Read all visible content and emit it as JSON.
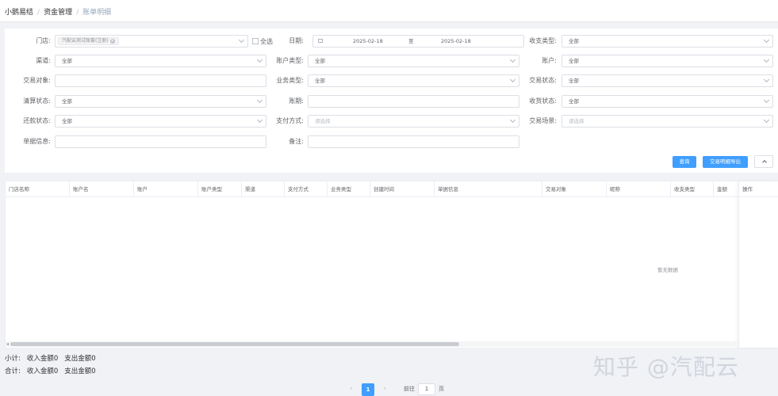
{
  "breadcrumb": {
    "items": [
      "小鹅易结",
      "资金管理",
      "账单明细"
    ],
    "separator": "/"
  },
  "filters": {
    "store": {
      "label": "门店:",
      "tag": "汽配云测试账套(注册)",
      "select_all_label": "全选"
    },
    "date": {
      "label": "日期:",
      "start": "2025-02-18",
      "separator": "至",
      "end": "2025-02-18"
    },
    "income_type": {
      "label": "收支类型:",
      "value": "全部"
    },
    "channel": {
      "label": "渠道:",
      "value": "全部"
    },
    "account_type": {
      "label": "账户类型:",
      "value": "全部"
    },
    "account": {
      "label": "账户:",
      "value": "全部"
    },
    "trade_object": {
      "label": "交易对象:",
      "value": ""
    },
    "business_type": {
      "label": "业务类型:",
      "value": "全部"
    },
    "trade_status": {
      "label": "交易状态:",
      "value": "全部"
    },
    "clear_status": {
      "label": "清算状态:",
      "value": "全部"
    },
    "period": {
      "label": "账期:",
      "value": ""
    },
    "receive_status": {
      "label": "收货状态:",
      "value": "全部"
    },
    "repay_status": {
      "label": "还款状态:",
      "value": "全部"
    },
    "pay_method": {
      "label": "支付方式:",
      "placeholder": "请选择"
    },
    "trade_scene": {
      "label": "交易场景:",
      "placeholder": "请选择"
    },
    "doc_info": {
      "label": "单据信息:",
      "value": ""
    },
    "remark": {
      "label": "备注:",
      "value": ""
    }
  },
  "actions": {
    "query": "查询",
    "export": "交易明细导出"
  },
  "table": {
    "columns": [
      "门店名称",
      "账户名",
      "账户",
      "账户类型",
      "渠道",
      "支付方式",
      "业务类型",
      "创建时间",
      "单据信息",
      "交易对象",
      "昵称",
      "收支类型",
      "金额"
    ],
    "fixed_column": "操作",
    "empty_text": "暂无数据"
  },
  "summary": {
    "subtotal": {
      "label": "小计:",
      "income": "收入金额0",
      "expense": "支出金额0"
    },
    "total": {
      "label": "合计:",
      "income": "收入金额0",
      "expense": "支出金额0"
    }
  },
  "pagination": {
    "current_page": "1",
    "goto_label": "前往",
    "goto_value": "1",
    "page_suffix": "页"
  },
  "watermark": "知乎 @汽配云",
  "colors": {
    "primary": "#409eff",
    "background": "#f0f2f5"
  },
  "icons": [
    "calendar-icon",
    "chevron-down-icon",
    "chevron-up-icon",
    "chevron-left-icon",
    "chevron-right-icon",
    "tag-close-icon"
  ]
}
